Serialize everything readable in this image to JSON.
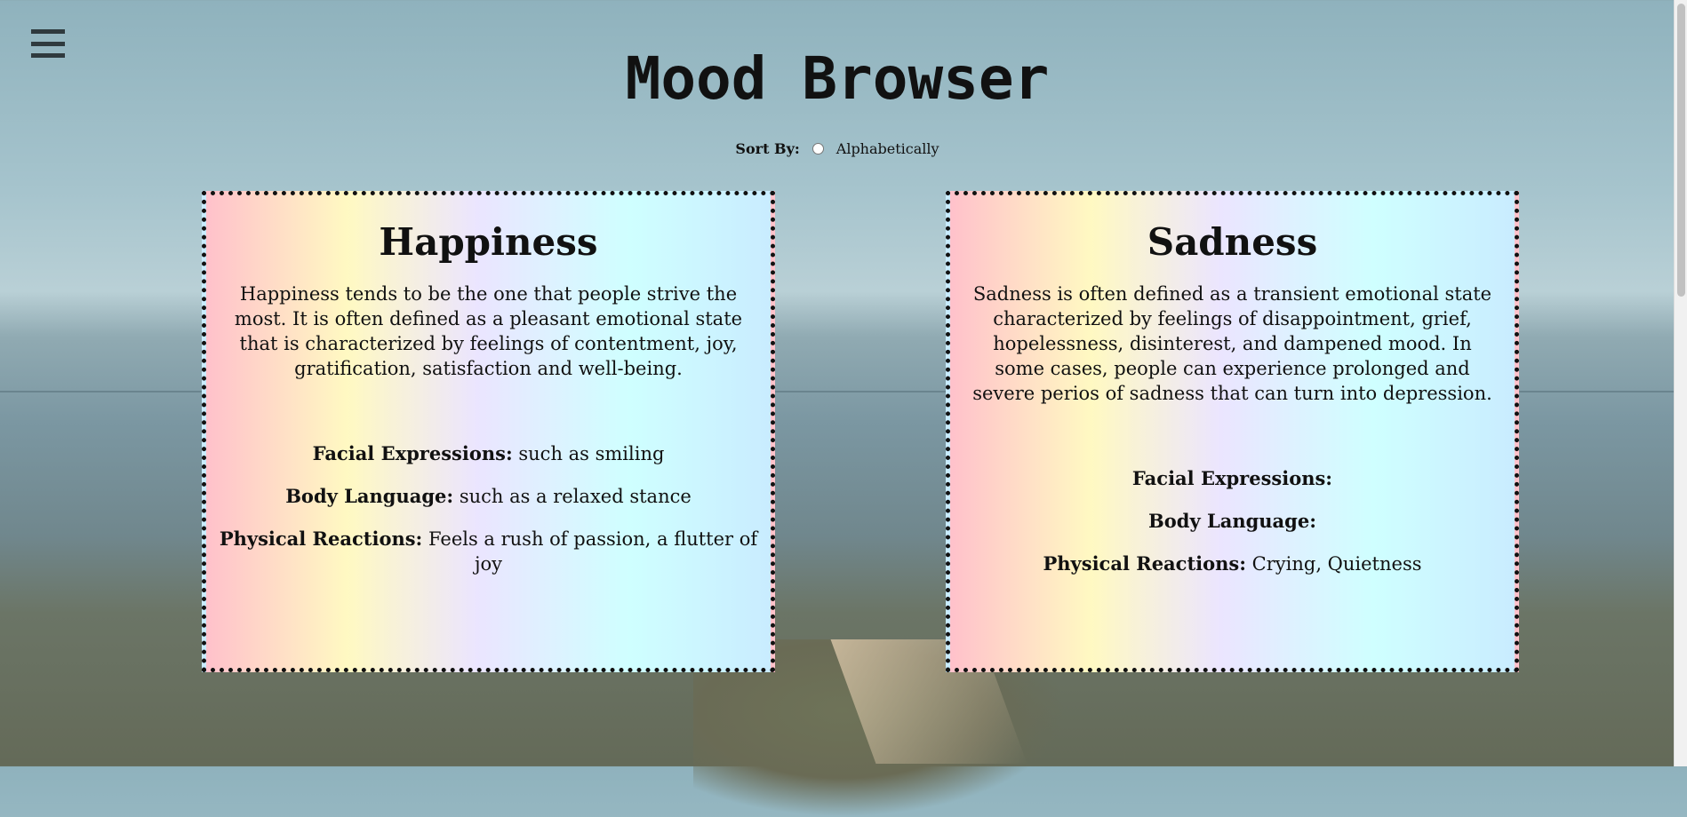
{
  "header": {
    "title": "Mood Browser"
  },
  "sort": {
    "label": "Sort By:",
    "option": "Alphabetically"
  },
  "moods": [
    {
      "name": "Happiness",
      "description": "Happiness tends to be the one that people strive the most. It is often defined as a pleasant emotional state that is characterized by feelings of contentment, joy, gratification, satisfaction and well-being.",
      "facial_label": "Facial Expressions:",
      "facial_value": " such as smiling",
      "body_label": "Body Language:",
      "body_value": " such as a relaxed stance",
      "physical_label": "Physical Reactions:",
      "physical_value": " Feels a rush of passion, a flutter of joy"
    },
    {
      "name": "Sadness",
      "description": "Sadness is often defined as a transient emotional state characterized by feelings of disappointment, grief, hopelessness, disinterest, and dampened mood. In some cases, people can experience prolonged and severe perios of sadness that can turn into depression.",
      "facial_label": "Facial Expressions:",
      "facial_value": "",
      "body_label": "Body Language:",
      "body_value": "",
      "physical_label": "Physical Reactions:",
      "physical_value": " Crying, Quietness"
    }
  ],
  "colors": {
    "card_border": "#111111",
    "gradient": [
      "#ffc1cb",
      "#fff9c2",
      "#ebe5ff",
      "#cfffff",
      "#c9ecff"
    ]
  },
  "icons": {
    "menu": "hamburger-icon"
  }
}
